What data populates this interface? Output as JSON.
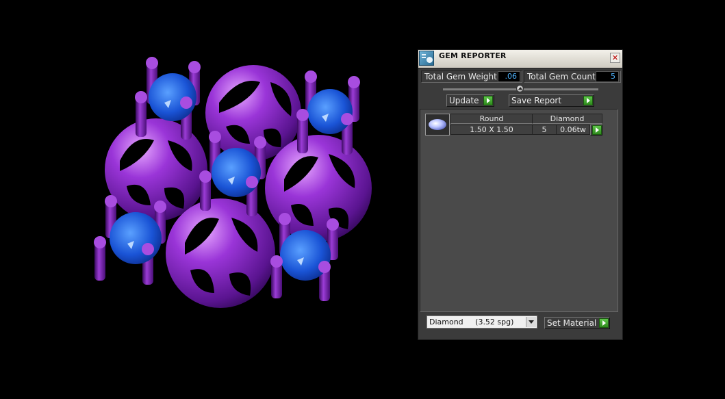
{
  "panel": {
    "title": "GEM REPORTER",
    "close_glyph": "✕",
    "total_weight_label": "Total Gem Weight",
    "total_weight_value": ".06",
    "total_count_label": "Total Gem Count",
    "total_count_value": "5",
    "update_label": "Update",
    "save_report_label": "Save Report",
    "set_material_label": "Set Material",
    "material_selected": "Diamond     (3.52 spg)"
  },
  "gem_table": {
    "rows": [
      {
        "shape": "Round",
        "material": "Diamond",
        "size": "1.50 X 1.50",
        "count": "5",
        "weight": "0.06tw"
      }
    ]
  },
  "viewport": {
    "metal_color": "#8a2bc8",
    "gem_color": "#1c5fe0",
    "background": "#000000"
  },
  "icons": [
    "gem-reporter-app-icon",
    "close-icon",
    "play-arrow-icon",
    "dropdown-arrow-icon",
    "round-gem-thumbnail"
  ]
}
